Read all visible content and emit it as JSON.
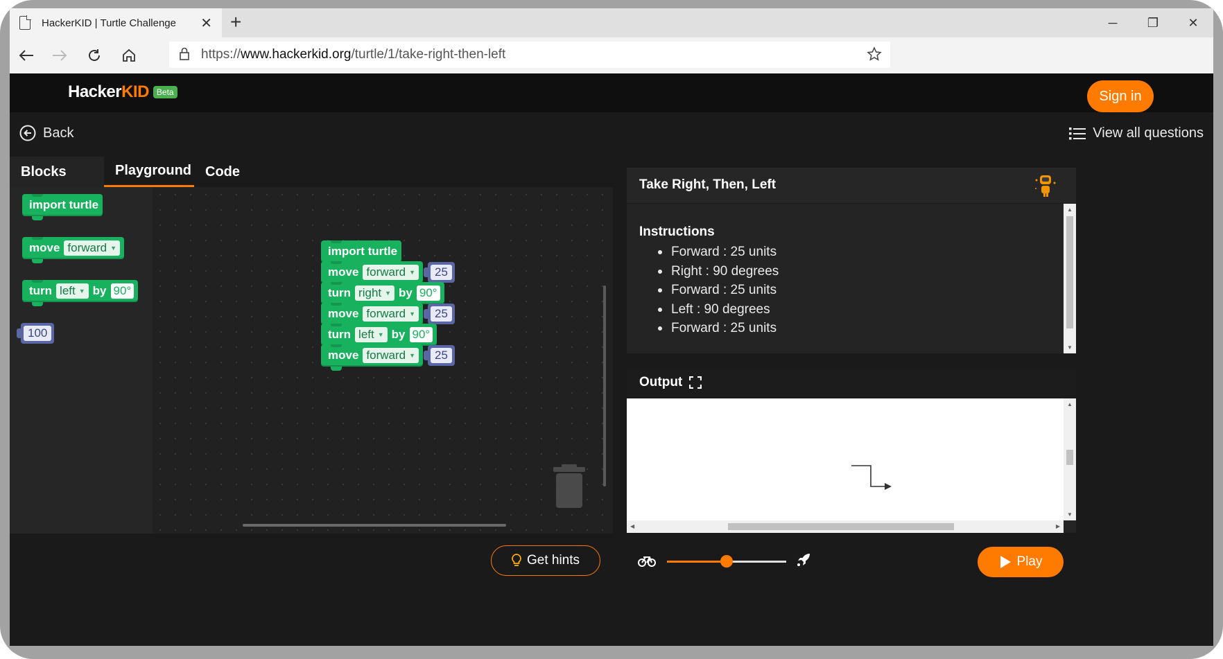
{
  "browser": {
    "tab_title": "HackerKID | Turtle Challenge",
    "url_prefix": "https://",
    "url_domain": "www.hackerkid.org",
    "url_path": "/turtle/1/take-right-then-left"
  },
  "site": {
    "logo_part1": "Hacker",
    "logo_part2": "KID",
    "logo_badge": "Beta",
    "signin_label": "Sign in",
    "brand_color": "#ff7b00"
  },
  "nav": {
    "back_label": "Back",
    "view_all_label": "View all questions"
  },
  "editor": {
    "tabs": [
      {
        "label": "Blocks",
        "active": false
      },
      {
        "label": "Playground",
        "active": true
      },
      {
        "label": "Code",
        "active": false
      }
    ],
    "toolbox": {
      "import_label": "import turtle",
      "move_label": "move",
      "move_dir": "forward",
      "turn_label": "turn",
      "turn_dir": "left",
      "by_label": "by",
      "angle": "90°",
      "number": "100"
    },
    "program": [
      {
        "kind": "import",
        "label": "import turtle"
      },
      {
        "kind": "move",
        "label": "move",
        "dir": "forward",
        "value": "25"
      },
      {
        "kind": "turn",
        "label": "turn",
        "dir": "right",
        "by": "by",
        "angle": "90°"
      },
      {
        "kind": "move",
        "label": "move",
        "dir": "forward",
        "value": "25"
      },
      {
        "kind": "turn",
        "label": "turn",
        "dir": "left",
        "by": "by",
        "angle": "90°"
      },
      {
        "kind": "move",
        "label": "move",
        "dir": "forward",
        "value": "25"
      }
    ],
    "hints_label": "Get hints"
  },
  "question": {
    "title": "Take Right, Then, Left",
    "instructions_title": "Instructions",
    "instructions": [
      "Forward : 25 units",
      "Right : 90 degrees",
      "Forward : 25 units",
      "Left : 90 degrees",
      "Forward : 25 units"
    ]
  },
  "output": {
    "title": "Output",
    "speed_level": 0.5,
    "play_label": "Play"
  }
}
